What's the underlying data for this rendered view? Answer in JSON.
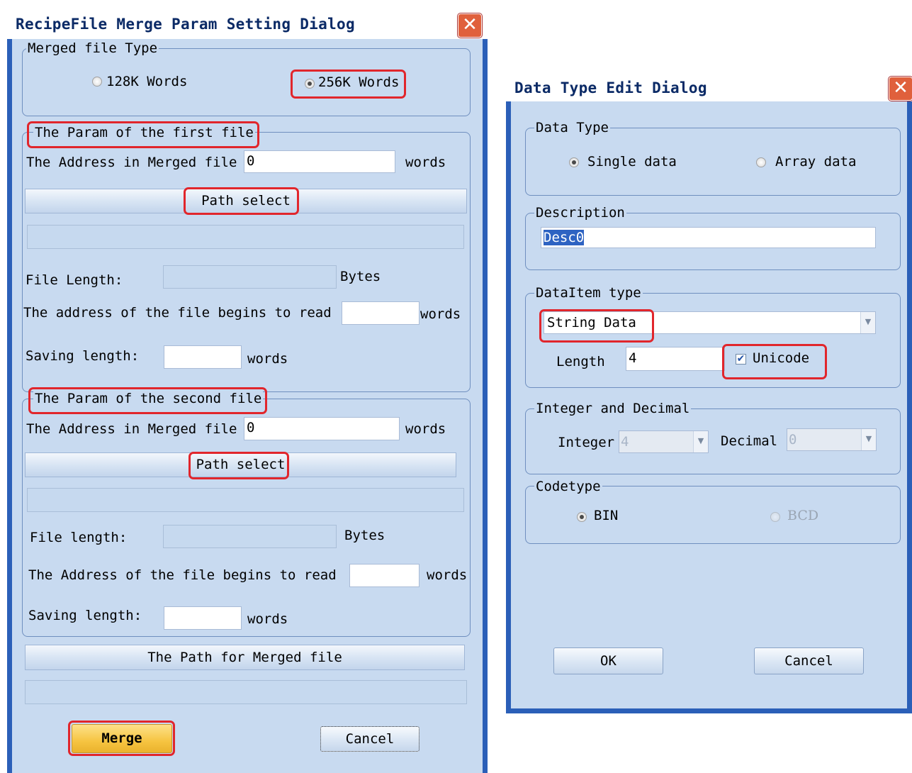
{
  "recipe_dialog": {
    "title": "RecipeFile Merge Param Setting Dialog",
    "close_glyph": "✕",
    "merged_type": {
      "legend": "Merged file Type",
      "option_128k": "128K Words",
      "option_256k": "256K Words",
      "selected": "256K Words"
    },
    "first_file": {
      "legend": "The Param of the first file",
      "address_label": "The Address in Merged file",
      "address_value": "0",
      "address_unit": "words",
      "path_button": "Path select",
      "file_length_label": "File Length:",
      "file_length_unit": "Bytes",
      "begin_label": "The address of the file begins to read",
      "begin_unit": "words",
      "saving_label": "Saving length:",
      "saving_unit": "words"
    },
    "second_file": {
      "legend": "The Param of the second file",
      "address_label": "The Address in Merged file",
      "address_value": "0",
      "address_unit": "words",
      "path_button": "Path select",
      "file_length_label": "File length:",
      "file_length_unit": "Bytes",
      "begin_label": "The Address of the file begins to read",
      "begin_unit": "words",
      "saving_label": "Saving length:",
      "saving_unit": "words"
    },
    "merged_path_button": "The Path for Merged file",
    "merge_button": "Merge",
    "cancel_button": "Cancel"
  },
  "datatype_dialog": {
    "title": "Data Type Edit Dialog",
    "close_glyph": "✕",
    "data_type": {
      "legend": "Data Type",
      "option_single": "Single data",
      "option_array": "Array data",
      "selected": "Single data"
    },
    "description": {
      "legend": "Description",
      "value": "Desc0"
    },
    "data_item_type": {
      "legend": "DataItem type",
      "selected": "String Data",
      "length_label": "Length",
      "length_value": "4",
      "unicode_label": "Unicode",
      "unicode_checked": true
    },
    "integer_decimal": {
      "legend": "Integer and Decimal",
      "integer_label": "Integer",
      "integer_value": "4",
      "decimal_label": "Decimal",
      "decimal_value": "0"
    },
    "codetype": {
      "legend": "Codetype",
      "option_bin": "BIN",
      "option_bcd": "BCD",
      "selected": "BIN"
    },
    "ok_button": "OK",
    "cancel_button": "Cancel"
  },
  "colors": {
    "frame": "#2b5fb8",
    "client": "#c8daf0",
    "highlight": "#e1262c",
    "merge_button": "#f6c441",
    "close_button": "#e0603c"
  }
}
